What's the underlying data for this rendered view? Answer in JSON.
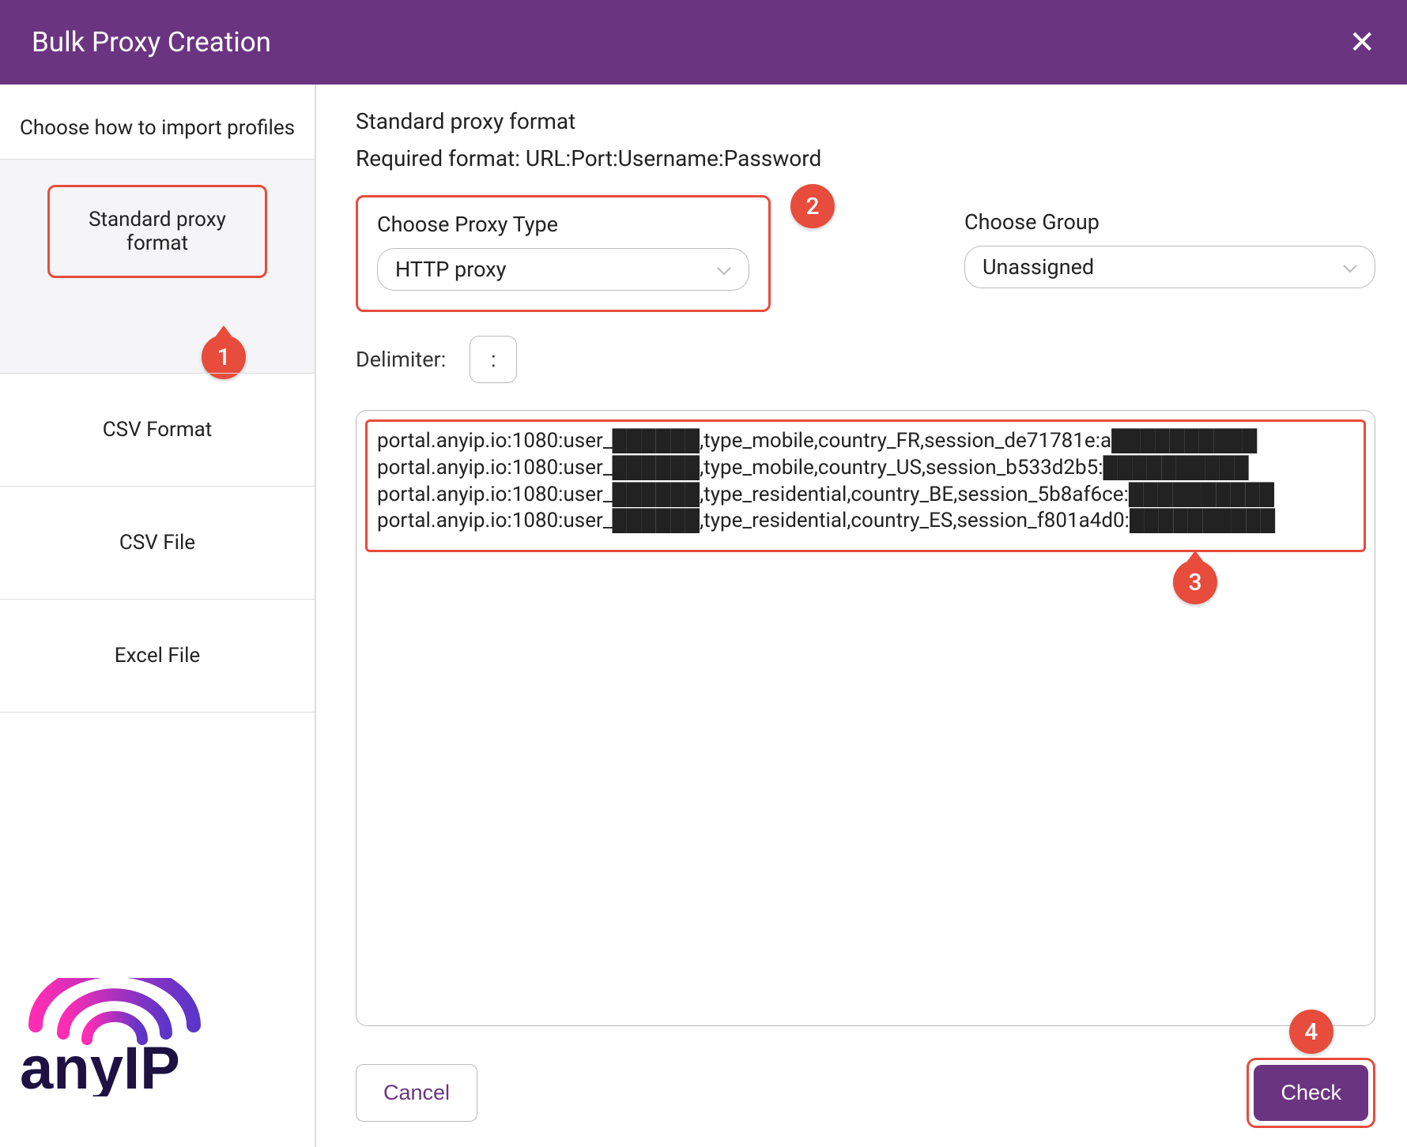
{
  "header": {
    "title": "Bulk Proxy Creation"
  },
  "sidebar": {
    "heading": "Choose how to import profiles",
    "items": [
      {
        "label": "Standard proxy format",
        "active": true
      },
      {
        "label": "CSV Format",
        "active": false
      },
      {
        "label": "CSV File",
        "active": false
      },
      {
        "label": "Excel File",
        "active": false
      }
    ]
  },
  "main": {
    "info_title": "Standard proxy format",
    "info_sub": "Required format: URL:Port:Username:Password",
    "proxy_type": {
      "label": "Choose Proxy Type",
      "value": "HTTP proxy"
    },
    "group": {
      "label": "Choose Group",
      "value": "Unassigned"
    },
    "delimiter_label": "Delimiter:",
    "delimiter_value": ":",
    "proxy_lines": "portal.anyip.io:1080:user_██████,type_mobile,country_FR,session_de71781e:a██████████\nportal.anyip.io:1080:user_██████,type_mobile,country_US,session_b533d2b5:██████████\nportal.anyip.io:1080:user_██████,type_residential,country_BE,session_5b8af6ce:██████████\nportal.anyip.io:1080:user_██████,type_residential,country_ES,session_f801a4d0:██████████"
  },
  "footer": {
    "cancel": "Cancel",
    "check": "Check"
  },
  "annotations": {
    "a1": "1",
    "a2": "2",
    "a3": "3",
    "a4": "4"
  },
  "logo": {
    "text": "anyIP"
  }
}
